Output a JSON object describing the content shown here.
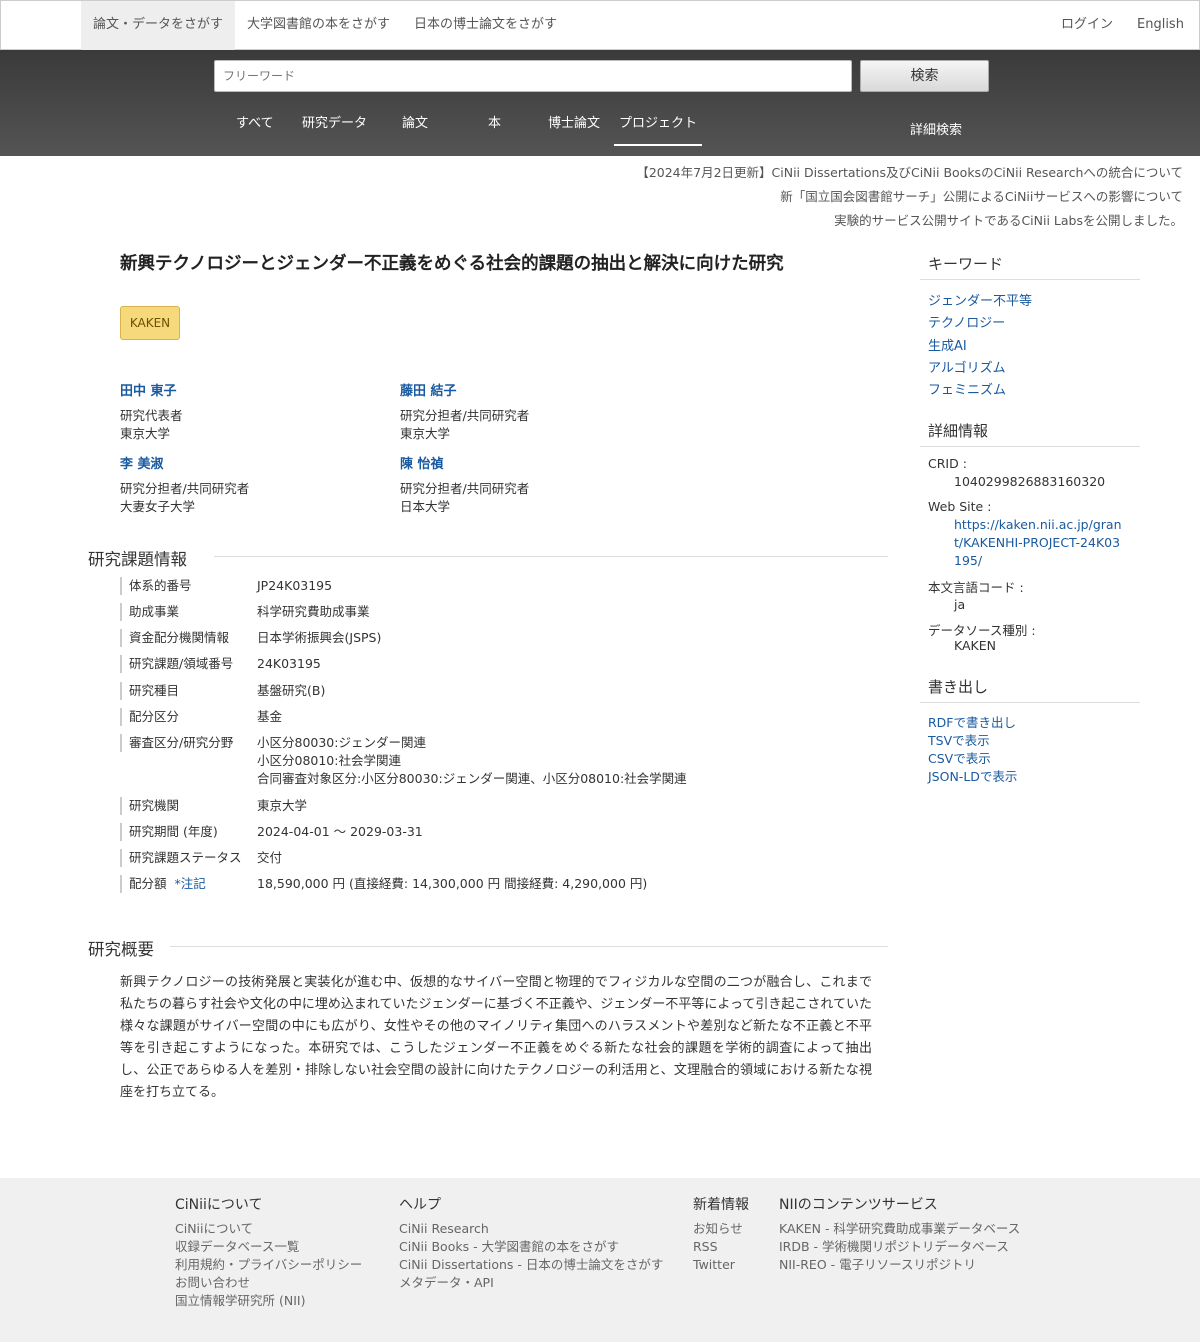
{
  "topnav": {
    "tabs": [
      "論文・データをさがす",
      "大学図書館の本をさがす",
      "日本の博士論文をさがす"
    ],
    "login": "ログイン",
    "language": "English"
  },
  "search": {
    "placeholder": "フリーワード",
    "button": "検索",
    "tabs": [
      "すべて",
      "研究データ",
      "論文",
      "本",
      "博士論文",
      "プロジェクト"
    ],
    "active_tab": "プロジェクト",
    "advanced": "詳細検索"
  },
  "notices": [
    "【2024年7月2日更新】CiNii Dissertations及びCiNii BooksのCiNii Researchへの統合について",
    "新「国立国会図書館サーチ」公開によるCiNiiサービスへの影響について",
    "実験的サービス公開サイトであるCiNii Labsを公開しました。"
  ],
  "project": {
    "title": "新興テクノロジーとジェンダー不正義をめぐる社会的課題の抽出と解決に向けた研究",
    "badge": "KAKEN",
    "people": [
      {
        "name": "田中 東子",
        "role": "研究代表者",
        "org": "東京大学"
      },
      {
        "name": "藤田 結子",
        "role": "研究分担者/共同研究者",
        "org": "東京大学"
      },
      {
        "name": "李 美淑",
        "role": "研究分担者/共同研究者",
        "org": "大妻女子大学"
      },
      {
        "name": "陳 怡禎",
        "role": "研究分担者/共同研究者",
        "org": "日本大学"
      }
    ]
  },
  "info": {
    "heading": "研究課題情報",
    "rows": [
      {
        "label": "体系的番号",
        "value": "JP24K03195"
      },
      {
        "label": "助成事業",
        "value": "科学研究費助成事業"
      },
      {
        "label": "資金配分機関情報",
        "value": "日本学術振興会(JSPS)"
      },
      {
        "label": "研究課題/領域番号",
        "value": "24K03195"
      },
      {
        "label": "研究種目",
        "value": "基盤研究(B)"
      },
      {
        "label": "配分区分",
        "value": "基金"
      },
      {
        "label": "審査区分/研究分野",
        "value": "小区分80030:ジェンダー関連",
        "value2": "小区分08010:社会学関連",
        "value3": "合同審査対象区分:小区分80030:ジェンダー関連、小区分08010:社会学関連"
      },
      {
        "label": "研究機関",
        "value": "東京大学"
      },
      {
        "label": "研究期間 (年度)",
        "value": "2024-04-01 〜 2029-03-31"
      },
      {
        "label": "研究課題ステータス",
        "value": "交付"
      },
      {
        "label": "配分額",
        "note": "*注記",
        "value": "18,590,000 円 (直接経費: 14,300,000 円 間接経費: 4,290,000 円)"
      }
    ]
  },
  "summary": {
    "heading": "研究概要",
    "text": "新興テクノロジーの技術発展と実装化が進む中、仮想的なサイバー空間と物理的でフィジカルな空間の二つが融合し、これまで私たちの暮らす社会や文化の中に埋め込まれていたジェンダーに基づく不正義や、ジェンダー不平等によって引き起こされていた様々な課題がサイバー空間の中にも広がり、女性やその他のマイノリティ集団へのハラスメントや差別など新たな不正義と不平等を引き起こすようになった。本研究では、こうしたジェンダー不正義をめぐる新たな社会的課題を学術的調査によって抽出し、公正であらゆる人を差別・排除しない社会空間の設計に向けたテクノロジーの利活用と、文理融合的領域における新たな視座を打ち立てる。"
  },
  "sidebar": {
    "keywords_heading": "キーワード",
    "keywords": [
      "ジェンダー不平等",
      "テクノロジー",
      "生成AI",
      "アルゴリズム",
      "フェミニズム"
    ],
    "details_heading": "詳細情報",
    "crid_label": "CRID :",
    "crid": "1040299826883160320",
    "website_label": "Web Site :",
    "website": "https://kaken.nii.ac.jp/grant/KAKENHI-PROJECT-24K03195/",
    "lang_label": "本文言語コード :",
    "lang": "ja",
    "source_label": "データソース種別 :",
    "source": "KAKEN",
    "export_heading": "書き出し",
    "exports": [
      "RDFで書き出し",
      "TSVで表示",
      "CSVで表示",
      "JSON-LDで表示"
    ]
  },
  "footer": {
    "cols": [
      {
        "heading": "CiNiiについて",
        "links": [
          "CiNiiについて",
          "収録データベース一覧",
          "利用規約・プライバシーポリシー",
          "お問い合わせ",
          "国立情報学研究所 (NII)"
        ]
      },
      {
        "heading": "ヘルプ",
        "links": [
          "CiNii Research",
          "CiNii Books - 大学図書館の本をさがす",
          "CiNii Dissertations - 日本の博士論文をさがす",
          "メタデータ・API"
        ]
      },
      {
        "heading": "新着情報",
        "links": [
          "お知らせ",
          "RSS",
          "Twitter"
        ]
      },
      {
        "heading": "NIIのコンテンツサービス",
        "links": [
          "KAKEN - 科学研究費助成事業データベース",
          "IRDB - 学術機関リポジトリデータベース",
          "NII-REO - 電子リソースリポジトリ"
        ]
      }
    ]
  }
}
